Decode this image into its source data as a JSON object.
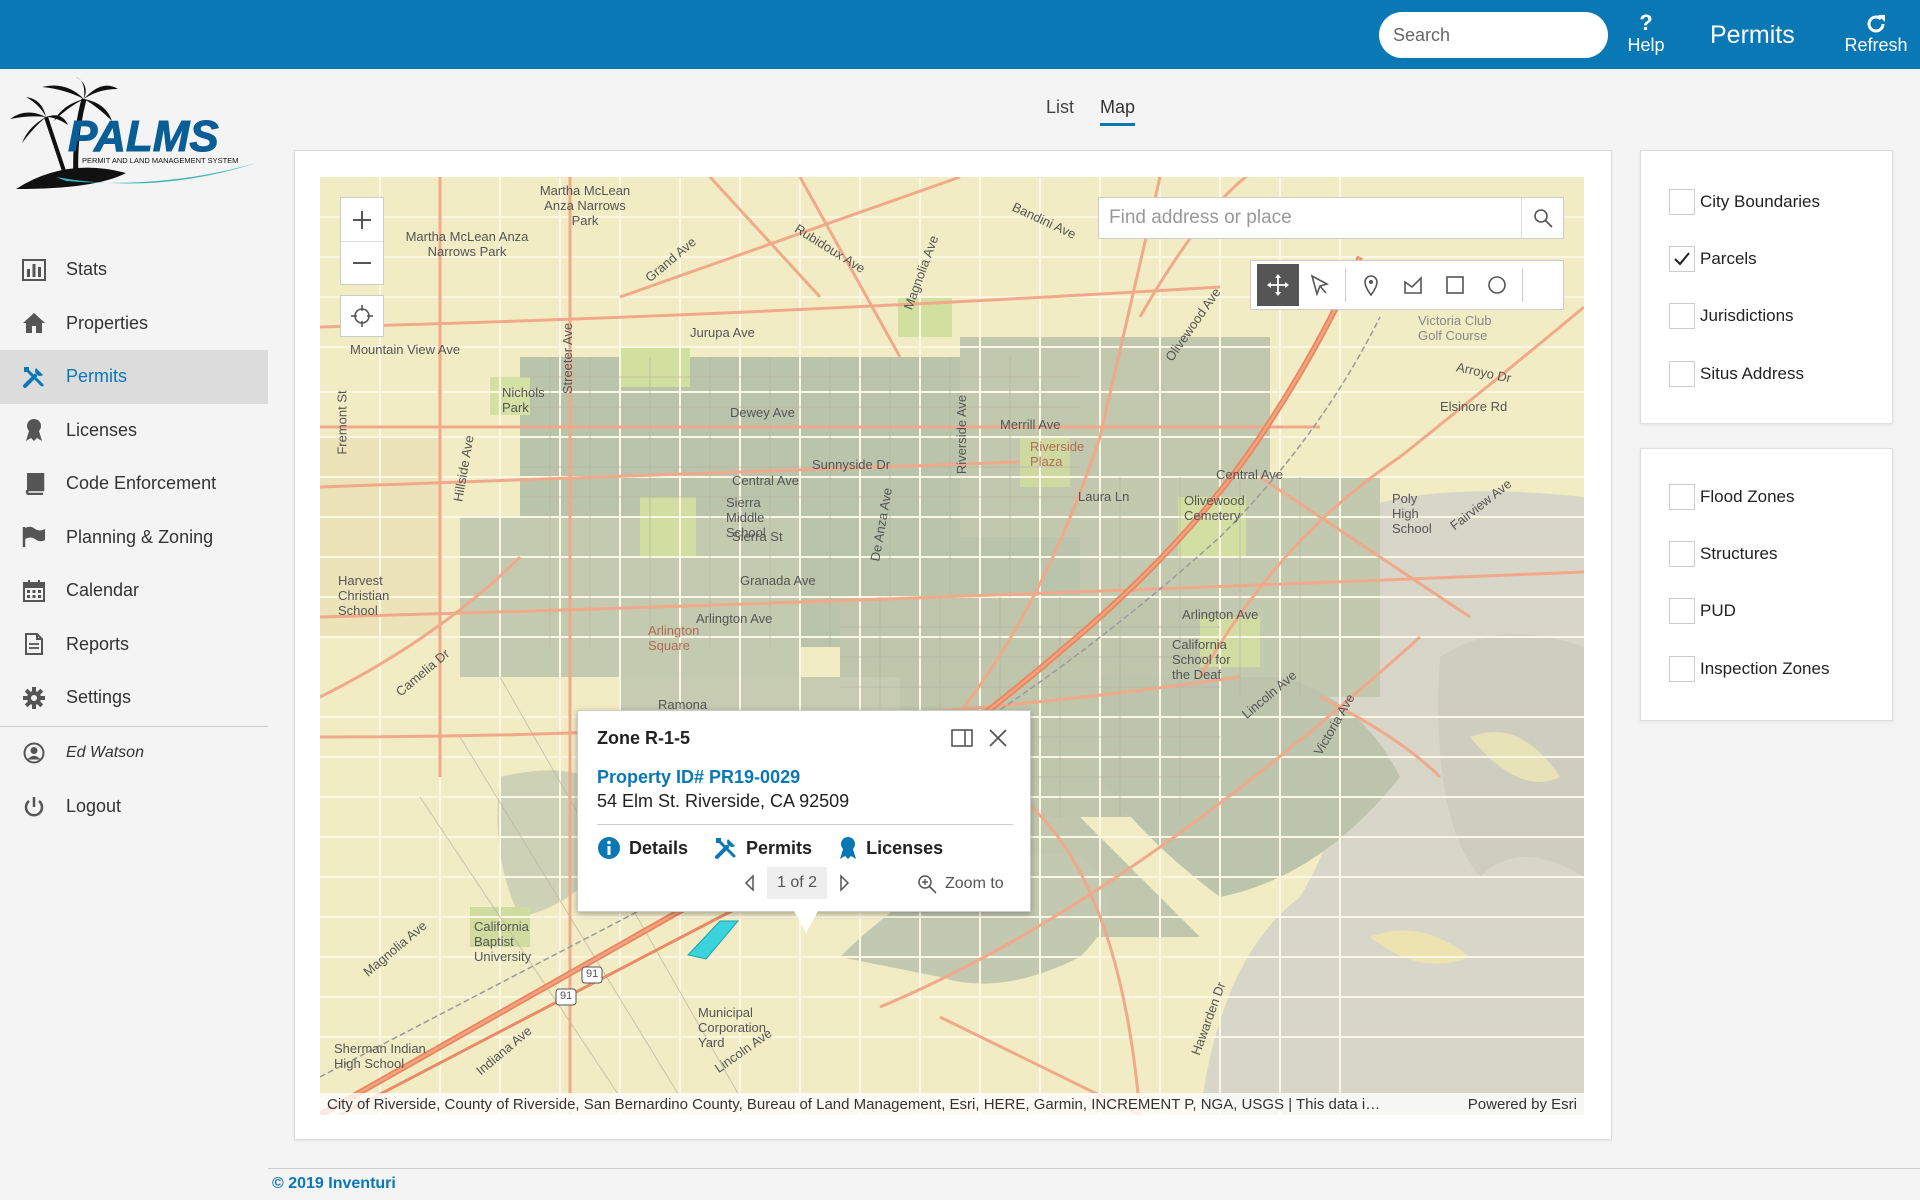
{
  "topbar": {
    "search_placeholder": "Search",
    "help_label": "Help",
    "title": "Permits",
    "refresh_label": "Refresh",
    "color": "#0a78b5"
  },
  "logo": {
    "name": "PALMS",
    "tagline": "PERMIT AND LAND MANAGEMENT SYSTEM"
  },
  "sidebar": {
    "items": [
      {
        "label": "Stats",
        "icon": "bar-chart-icon"
      },
      {
        "label": "Properties",
        "icon": "home-icon"
      },
      {
        "label": "Permits",
        "icon": "tools-icon",
        "active": true
      },
      {
        "label": "Licenses",
        "icon": "ribbon-icon"
      },
      {
        "label": "Code Enforcement",
        "icon": "book-icon"
      },
      {
        "label": "Planning & Zoning",
        "icon": "flag-icon"
      },
      {
        "label": "Calendar",
        "icon": "calendar-icon"
      },
      {
        "label": "Reports",
        "icon": "document-icon"
      },
      {
        "label": "Settings",
        "icon": "gear-icon"
      }
    ],
    "user": "Ed Watson",
    "logout": "Logout"
  },
  "tabs": [
    {
      "label": "List",
      "active": false
    },
    {
      "label": "Map",
      "active": true
    }
  ],
  "map": {
    "search_placeholder": "Find address or place",
    "attribution": "City of Riverside, County of Riverside, San Bernardino County, Bureau of Land Management, Esri, HERE, Garmin, INCREMENT P, NGA, USGS | This data i…",
    "powered_by": "Powered by Esri",
    "labels": [
      "Martha McLean Anza Narrows Park",
      "Martha McLean Anza Narrows Park",
      "Grand Ave",
      "Rubidoux Ave",
      "Jurupa Ave",
      "Magnolia Ave",
      "Mountain View Ave",
      "Nichols Park",
      "Dewey Ave",
      "Merrill Ave",
      "Riverside Plaza",
      "Sunnyside Dr",
      "Central Ave",
      "Sierra Middle School",
      "Sierra St",
      "Laura Ln",
      "Olivewood Cemetery",
      "Central Ave",
      "Poly High School",
      "Elsinore Rd",
      "Arroyo Dr",
      "Victoria Club Golf Course",
      "Granada Ave",
      "Arlington Ave",
      "Arlington Square",
      "Arlington Ave",
      "California School for the Deaf",
      "Harvest Christian School",
      "Camelia Dr",
      "Ramona",
      "Lincoln Ave",
      "Victoria Ave",
      "California Baptist University",
      "Magnolia Ave",
      "Municipal Corporation Yard",
      "Lincoln Ave",
      "Sherman Indian High School",
      "Indiana Ave",
      "Fremont St",
      "Hillside Ave",
      "Fairview Ave",
      "Olivewood Ave",
      "Bandini Ave",
      "Streeter Ave",
      "Riverside Ave",
      "De Anza Ave",
      "Hawarden Dr",
      "91",
      "91"
    ]
  },
  "popup": {
    "title": "Zone R-1-5",
    "property_link": "Property ID# PR19-0029",
    "address": "54 Elm St. Riverside, CA 92509",
    "actions": [
      "Details",
      "Permits",
      "Licenses"
    ],
    "pager": "1 of 2",
    "zoom_label": "Zoom to"
  },
  "layers_primary": [
    {
      "label": "City Boundaries",
      "checked": false
    },
    {
      "label": "Parcels",
      "checked": true
    },
    {
      "label": "Jurisdictions",
      "checked": false
    },
    {
      "label": "Situs Address",
      "checked": false
    }
  ],
  "layers_secondary": [
    {
      "label": "Flood Zones",
      "checked": false
    },
    {
      "label": "Structures",
      "checked": false
    },
    {
      "label": "PUD",
      "checked": false
    },
    {
      "label": "Inspection Zones",
      "checked": false
    }
  ],
  "footer": {
    "copyright": "© 2019 Inventuri"
  }
}
